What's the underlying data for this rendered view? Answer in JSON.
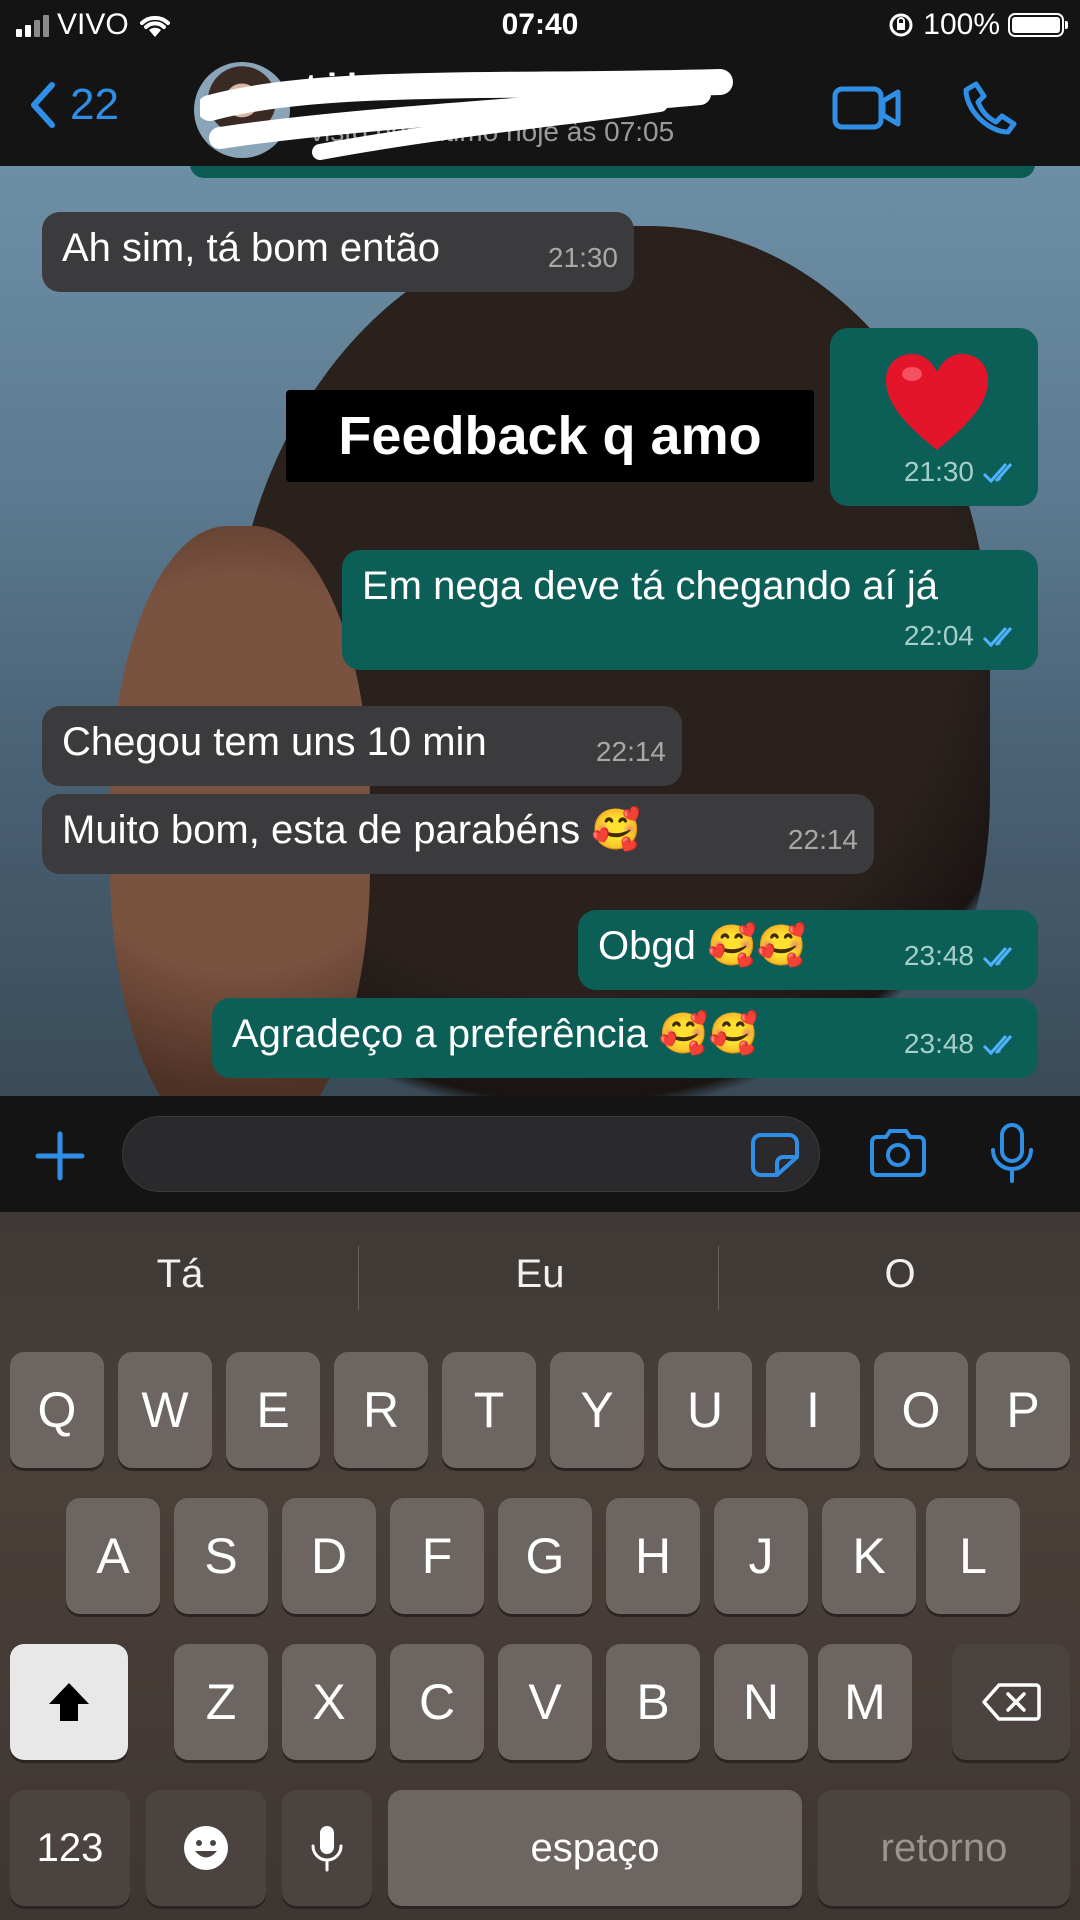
{
  "status_bar": {
    "carrier": "VIVO",
    "time": "07:40",
    "battery": "100%"
  },
  "header": {
    "back_count": "22",
    "contact_name": "t i i",
    "last_seen": "visto por último hoje às 07:05"
  },
  "sticker_text": "Feedback q amo",
  "messages": [
    {
      "dir": "in",
      "text": "Ah sim, tá bom então",
      "time": "21:30"
    },
    {
      "dir": "out",
      "text": "❤️",
      "time": "21:30"
    },
    {
      "dir": "out",
      "text": "Em nega deve tá chegando aí já",
      "time": "22:04"
    },
    {
      "dir": "in",
      "text": "Chegou tem uns 10 min",
      "time": "22:14"
    },
    {
      "dir": "in",
      "text": "Muito bom, esta de parabéns 🥰",
      "time": "22:14"
    },
    {
      "dir": "out",
      "text": "Obgd 🥰🥰",
      "time": "23:48"
    },
    {
      "dir": "out",
      "text": "Agradeço a preferência 🥰🥰",
      "time": "23:48"
    }
  ],
  "keyboard": {
    "suggestions": [
      "Tá",
      "Eu",
      "O"
    ],
    "row1": [
      "Q",
      "W",
      "E",
      "R",
      "T",
      "Y",
      "U",
      "I",
      "O",
      "P"
    ],
    "row2": [
      "A",
      "S",
      "D",
      "F",
      "G",
      "H",
      "J",
      "K",
      "L"
    ],
    "row3": [
      "Z",
      "X",
      "C",
      "V",
      "B",
      "N",
      "M"
    ],
    "numbers_key": "123",
    "space_key": "espaço",
    "return_key": "retorno"
  },
  "colors": {
    "accent": "#2f8fe6",
    "outgoing_bubble": "#0b5f57",
    "incoming_bubble": "#3b3b3d",
    "read_ticks": "#4fb3ff"
  }
}
